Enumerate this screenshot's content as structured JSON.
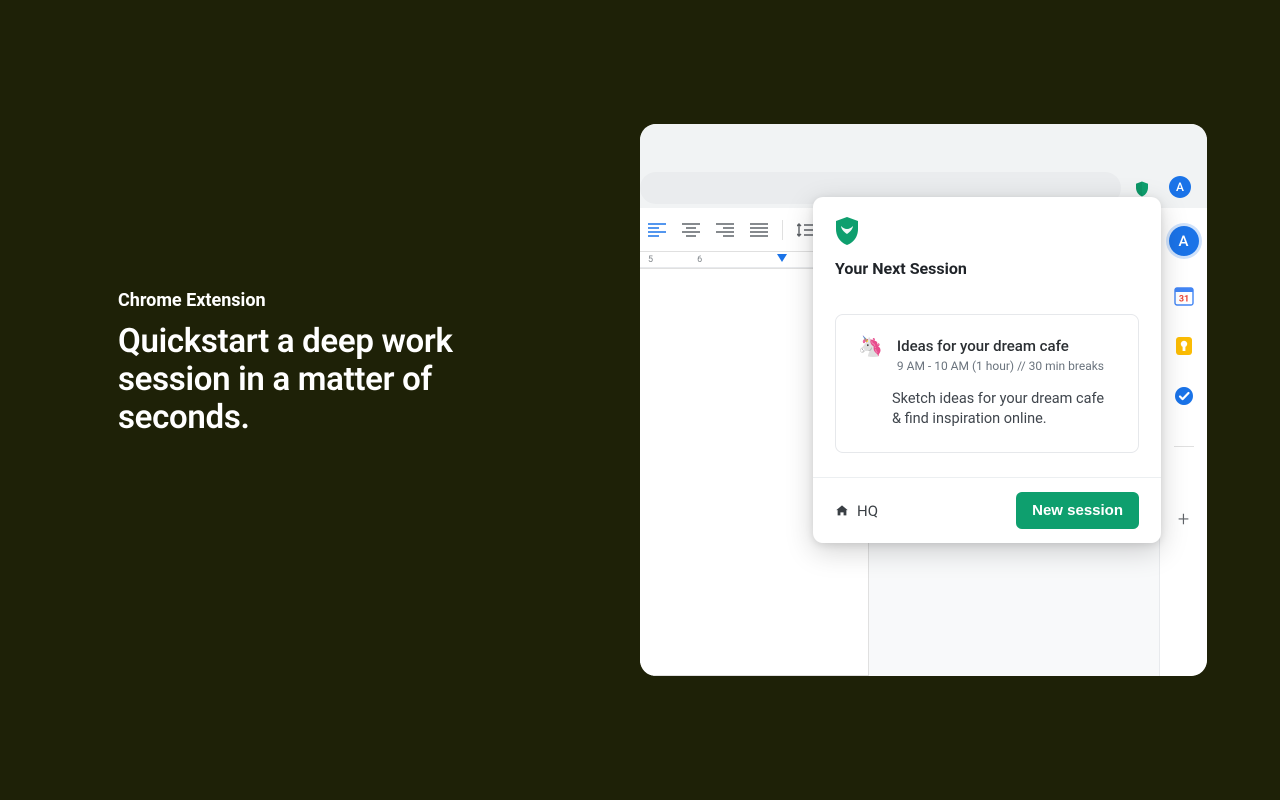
{
  "marketing": {
    "eyebrow": "Chrome Extension",
    "headline": "Quickstart a deep work session in a matter of seconds."
  },
  "chrome": {
    "avatar_letter": "A"
  },
  "docs": {
    "ruler": {
      "n5": "5",
      "n6": "6"
    },
    "sidepanel_avatar": "A"
  },
  "popup": {
    "title": "Your Next Session",
    "session": {
      "emoji": "🦄",
      "title": "Ideas for your dream cafe",
      "time": "9 AM - 10 AM (1 hour) // 30 min breaks",
      "description": "Sketch ideas for your dream cafe & find inspiration online."
    },
    "footer": {
      "hq_label": "HQ",
      "new_session_label": "New session"
    }
  }
}
